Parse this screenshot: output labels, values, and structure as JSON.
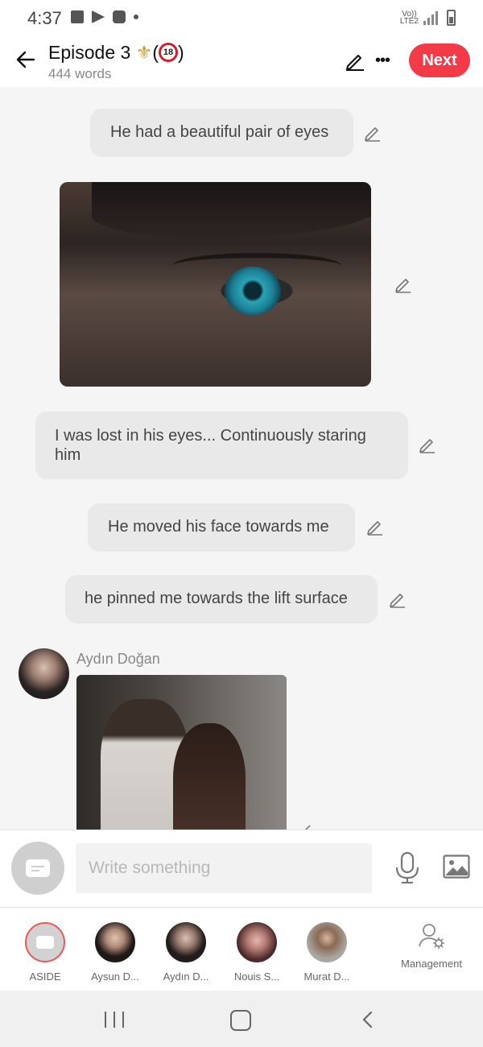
{
  "status_bar": {
    "time": "4:37",
    "network_top": "Vo))",
    "network_bottom": "LTE2"
  },
  "header": {
    "title": "Episode 3",
    "title_emoji": "⚜",
    "title_paren_open": "(",
    "age_badge": "18",
    "title_paren_close": ")",
    "word_count": "444 words",
    "next_label": "Next",
    "accent_color": "#f33a47"
  },
  "chat": {
    "messages": [
      {
        "text": "He had a beautiful pair of eyes"
      },
      {
        "text": "I was lost in his eyes... Continuously staring him"
      },
      {
        "text": "He moved his face towards me"
      },
      {
        "text": "he pinned me towards the lift surface"
      }
    ],
    "sender_name": "Aydın Doğan"
  },
  "composer": {
    "placeholder": "Write something"
  },
  "cast": [
    {
      "label": "ASIDE"
    },
    {
      "label": "Aysun D..."
    },
    {
      "label": "Aydın D..."
    },
    {
      "label": "Nouis S..."
    },
    {
      "label": "Murat D..."
    }
  ],
  "management_label": "Management"
}
